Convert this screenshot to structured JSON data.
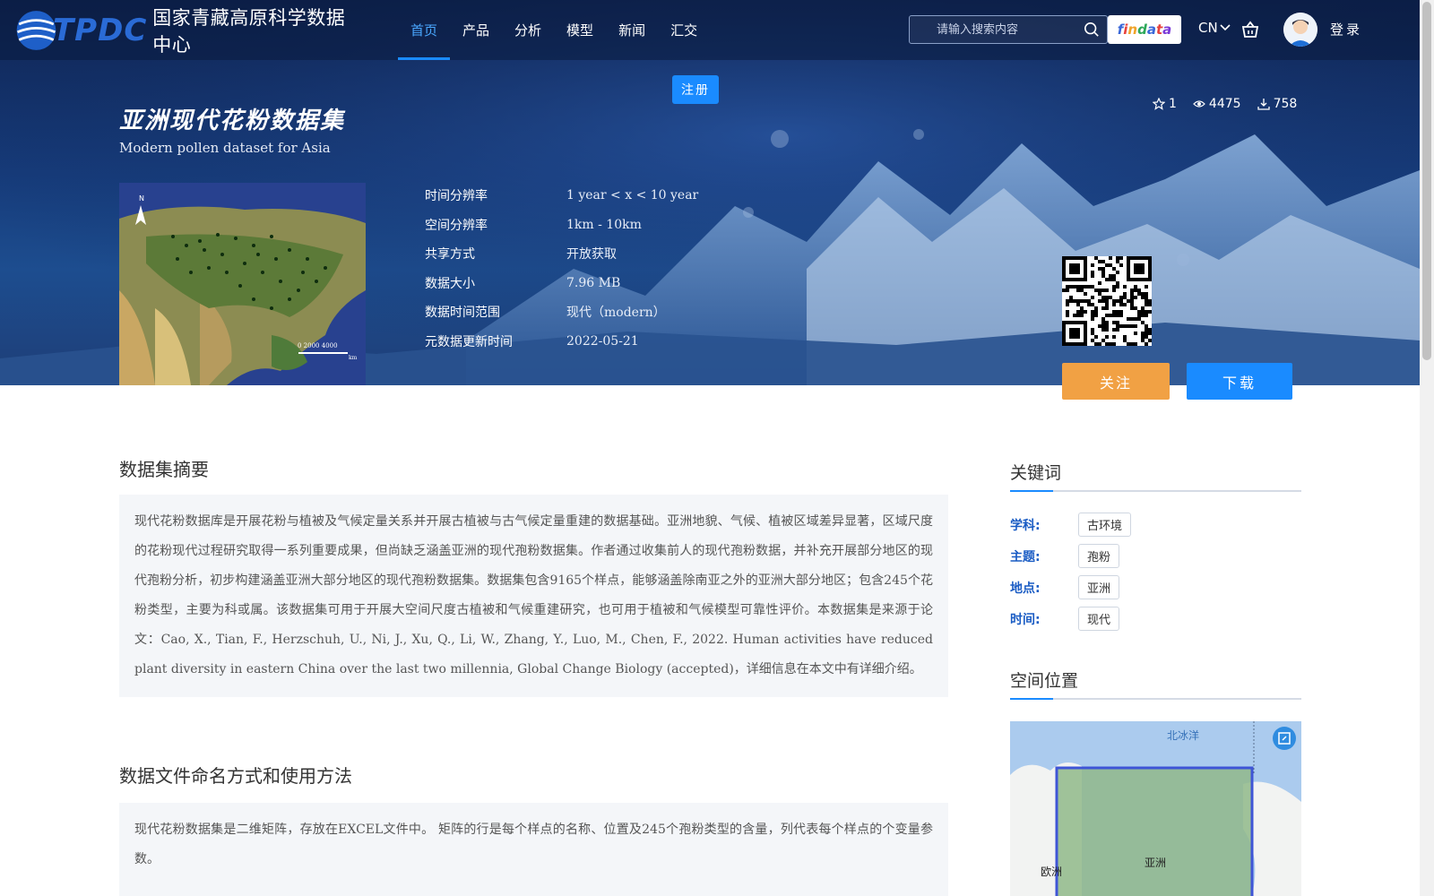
{
  "header": {
    "logo_text": "TPDC",
    "logo_cn": "国家青藏高原科学数据中心",
    "nav": [
      "首页",
      "产品",
      "分析",
      "模型",
      "新闻",
      "汇交"
    ],
    "search_placeholder": "请输入搜索内容",
    "findata": "findata",
    "lang": "CN",
    "login": "登录",
    "register": "注册"
  },
  "dataset": {
    "title_cn": "亚洲现代花粉数据集",
    "title_en": "Modern pollen dataset for Asia",
    "stars": "1",
    "views": "4475",
    "downloads": "758",
    "meta": [
      {
        "key": "时间分辨率",
        "value": "1 year < x < 10 year"
      },
      {
        "key": "空间分辨率",
        "value": "1km - 10km"
      },
      {
        "key": "共享方式",
        "value": "开放获取"
      },
      {
        "key": "数据大小",
        "value": "7.96 MB"
      },
      {
        "key": "数据时间范围",
        "value": "现代（modern）"
      },
      {
        "key": "元数据更新时间",
        "value": "2022-05-21"
      }
    ],
    "follow_label": "关注",
    "download_label": "下载",
    "thumb_scale": "0  2000  4000",
    "thumb_unit": "km",
    "thumb_north": "N"
  },
  "abstract": {
    "title": "数据集摘要",
    "text": "现代花粉数据库是开展花粉与植被及气候定量关系并开展古植被与古气候定量重建的数据基础。亚洲地貌、气候、植被区域差异显著，区域尺度的花粉现代过程研究取得一系列重要成果，但尚缺乏涵盖亚洲的现代孢粉数据集。作者通过收集前人的现代孢粉数据，并补充开展部分地区的现代孢粉分析，初步构建涵盖亚洲大部分地区的现代孢粉数据集。数据集包含9165个样点，能够涵盖除南亚之外的亚洲大部分地区；包含245个花粉类型，主要为科或属。该数据集可用于开展大空间尺度古植被和气候重建研究，也可用于植被和气候模型可靠性评价。本数据集是来源于论文：Cao, X., Tian, F., Herzschuh, U., Ni, J., Xu, Q., Li, W., Zhang, Y., Luo, M., Chen, F., 2022. Human activities have reduced plant diversity in eastern China over the last two millennia, Global Change Biology (accepted)，详细信息在本文中有详细介绍。"
  },
  "usage": {
    "title": "数据文件命名方式和使用方法",
    "text": "现代花粉数据集是二维矩阵，存放在EXCEL文件中。 矩阵的行是每个样点的名称、位置及245个孢粉类型的含量，列代表每个样点的个变量参数。"
  },
  "keywords": {
    "title": "关键词",
    "rows": [
      {
        "label": "学科:",
        "tag": "古环境"
      },
      {
        "label": "主题:",
        "tag": "孢粉"
      },
      {
        "label": "地点:",
        "tag": "亚洲"
      },
      {
        "label": "时间:",
        "tag": "现代"
      }
    ]
  },
  "location": {
    "title": "空间位置",
    "labels": {
      "arctic": "北冰洋",
      "asia": "亚洲",
      "europe": "欧洲"
    }
  },
  "colors": {
    "accent": "#1a8bff",
    "follow": "#f1a144",
    "keyword": "#1a5cc4"
  }
}
